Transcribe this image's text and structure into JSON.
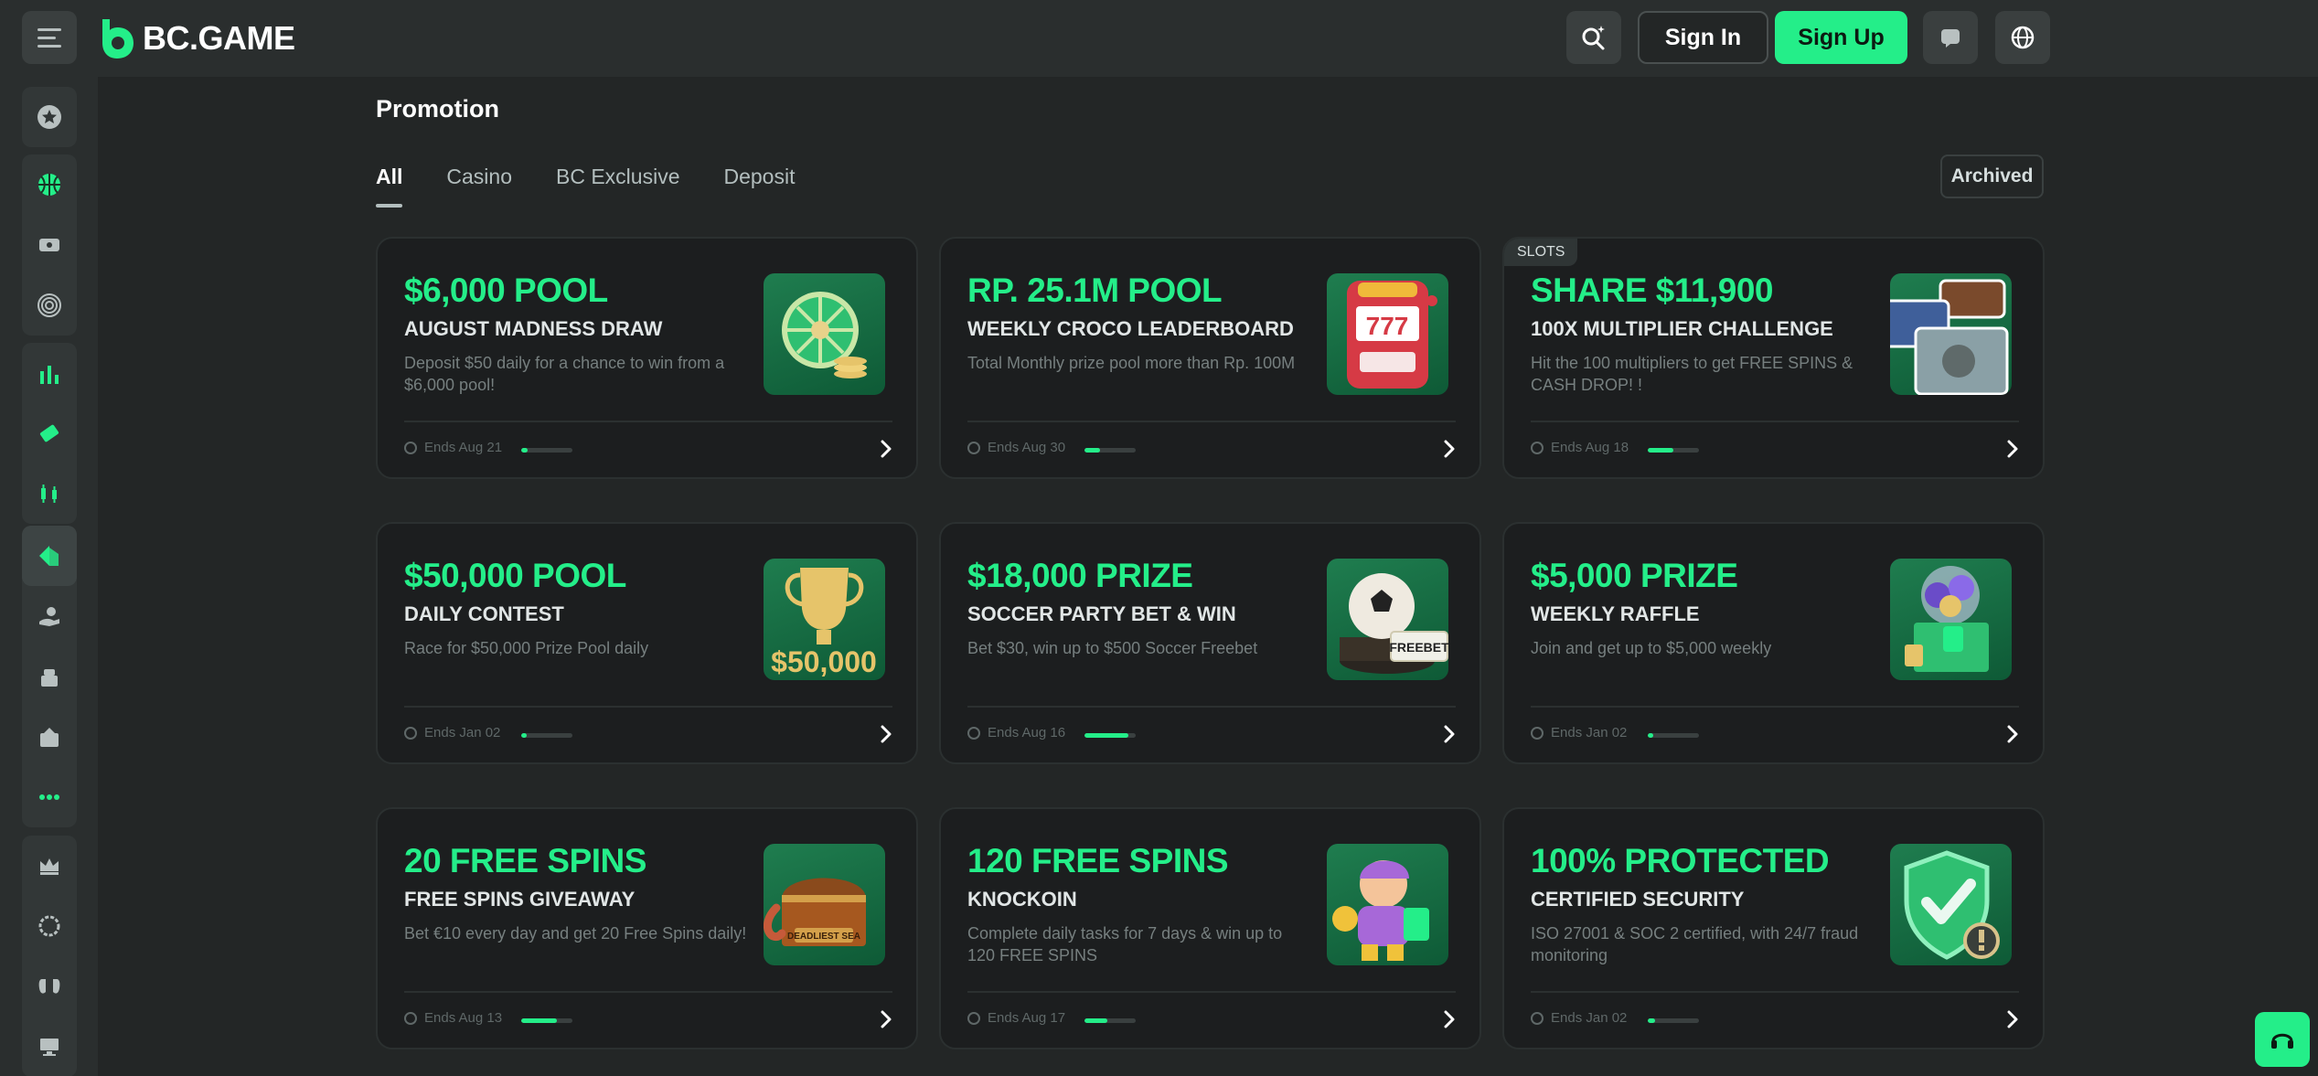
{
  "header": {
    "logo_text": "BC.GAME",
    "signin_label": "Sign In",
    "signup_label": "Sign Up",
    "icons": [
      "menu-icon",
      "search-icon",
      "chat-icon",
      "globe-icon"
    ]
  },
  "sidebar": {
    "items": [
      {
        "icon": "star-icon"
      },
      {
        "icon": "basketball-icon"
      },
      {
        "icon": "ticket-icon"
      },
      {
        "icon": "target-icon"
      },
      {
        "icon": "stats-icon"
      },
      {
        "icon": "lottery-icon"
      },
      {
        "icon": "trading-icon"
      },
      {
        "icon": "promotion-icon"
      },
      {
        "icon": "referral-icon"
      },
      {
        "icon": "vip-icon"
      },
      {
        "icon": "bank-icon"
      },
      {
        "icon": "more-icon"
      },
      {
        "icon": "crown-icon"
      },
      {
        "icon": "settings-icon"
      },
      {
        "icon": "gamepad-icon"
      },
      {
        "icon": "desktop-icon"
      }
    ]
  },
  "main": {
    "title": "Promotion",
    "tabs": [
      "All",
      "Casino",
      "BC Exclusive",
      "Deposit"
    ],
    "archived_label": "Archived"
  },
  "cards": [
    {
      "badge": "",
      "amount": "$6,000 POOL",
      "title": "AUGUST MADNESS DRAW",
      "desc": "Deposit $50 daily for a chance to win from a $6,000 pool!",
      "ends": "Ends Aug 21",
      "progress": 0.12,
      "thumb": "wheel"
    },
    {
      "badge": "",
      "amount": "RP. 25.1M POOL",
      "title": "WEEKLY CROCO LEADERBOARD",
      "desc": "Total Monthly prize pool more than Rp. 100M",
      "ends": "Ends Aug 30",
      "progress": 0.3,
      "thumb": "slot"
    },
    {
      "badge": "SLOTS",
      "amount": "SHARE $11,900",
      "title": "100X MULTIPLIER CHALLENGE",
      "desc": "Hit the 100 multipliers to get FREE SPINS & CASH DROP! !",
      "ends": "Ends Aug 18",
      "progress": 0.5,
      "thumb": "cards"
    },
    {
      "badge": "",
      "amount": "$50,000 POOL",
      "title": "DAILY CONTEST",
      "desc": "Race for $50,000 Prize Pool daily",
      "ends": "Ends Jan 02",
      "progress": 0.1,
      "thumb": "trophy"
    },
    {
      "badge": "",
      "amount": "$18,000 PRIZE",
      "title": "SOCCER PARTY BET & WIN",
      "desc": "Bet $30, win up to $500 Soccer Freebet",
      "ends": "Ends Aug 16",
      "progress": 0.85,
      "thumb": "soccer"
    },
    {
      "badge": "",
      "amount": "$5,000 PRIZE",
      "title": "WEEKLY RAFFLE",
      "desc": "Join and get up to $5,000 weekly",
      "ends": "Ends Jan 02",
      "progress": 0.1,
      "thumb": "box"
    },
    {
      "badge": "",
      "amount": "20 FREE SPINS",
      "title": "FREE SPINS GIVEAWAY",
      "desc": "Bet €10 every day and get 20 Free Spins daily!",
      "ends": "Ends Aug 13",
      "progress": 0.7,
      "thumb": "chest"
    },
    {
      "badge": "",
      "amount": "120 FREE SPINS",
      "title": "KNOCKOIN",
      "desc": "Complete daily tasks for 7 days & win up to 120 FREE SPINS",
      "ends": "Ends Aug 17",
      "progress": 0.45,
      "thumb": "character"
    },
    {
      "badge": "",
      "amount": "100% PROTECTED",
      "title": "CERTIFIED SECURITY",
      "desc": "ISO 27001 & SOC 2 certified, with 24/7 fraud monitoring",
      "ends": "Ends Jan 02",
      "progress": 0.15,
      "thumb": "shield"
    }
  ],
  "colors": {
    "accent": "#24ee89",
    "bg": "#232626",
    "card": "#1c1e1f",
    "sidebar": "#2a2e2e"
  }
}
